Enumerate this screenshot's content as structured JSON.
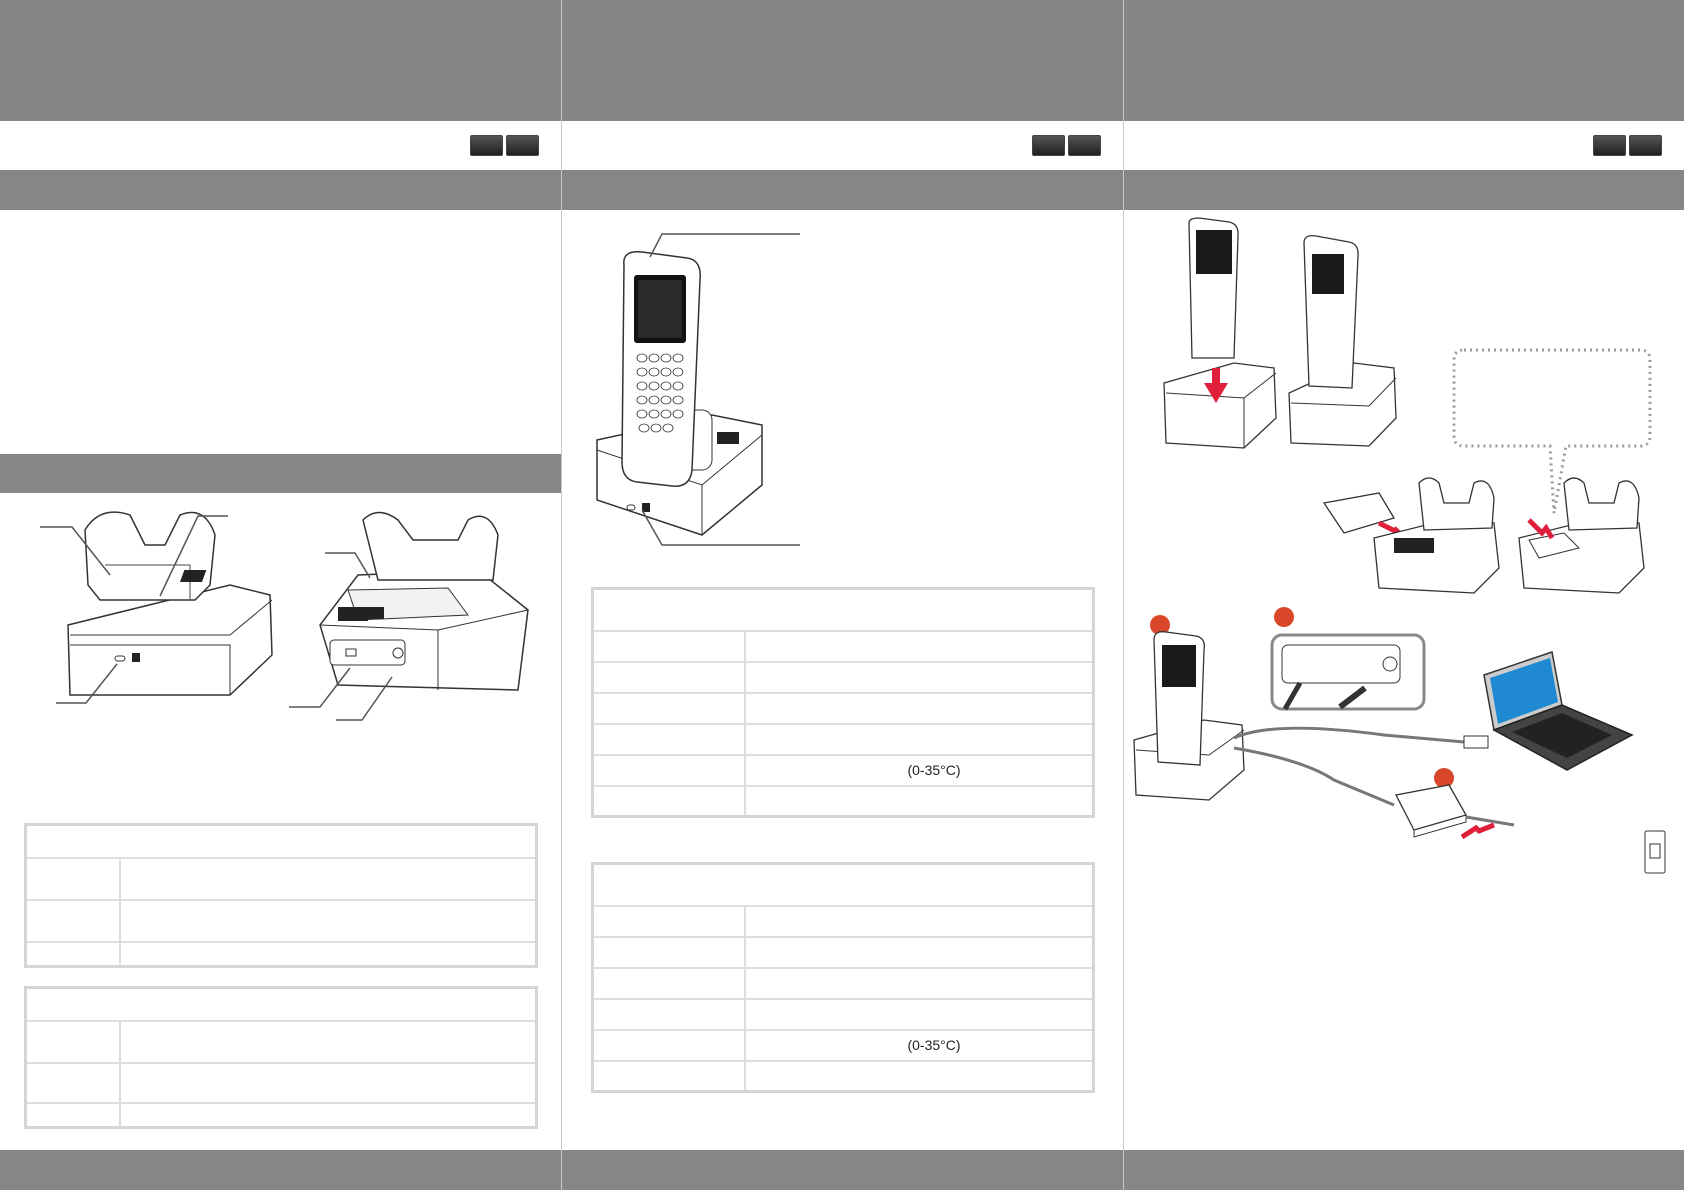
{
  "tables": {
    "cradle_spec_1": {
      "rows": [
        {
          "label": "",
          "value": ""
        },
        {
          "label": "",
          "value": ""
        },
        {
          "label": "",
          "value": ""
        },
        {
          "label": "",
          "value": ""
        },
        {
          "label": "",
          "value": "(0-35°C)"
        },
        {
          "label": "",
          "value": ""
        }
      ]
    },
    "cradle_spec_2": {
      "rows": [
        {
          "label": "",
          "value": ""
        },
        {
          "label": "",
          "value": ""
        },
        {
          "label": "",
          "value": ""
        },
        {
          "label": "",
          "value": ""
        },
        {
          "label": "",
          "value": "(0-35°C)"
        },
        {
          "label": "",
          "value": ""
        }
      ]
    }
  },
  "colors": {
    "band_gray": "#858687",
    "accent_red": "#d9472b",
    "arrow_red": "#e0203a",
    "laptop_screen": "#1f8ad1"
  },
  "icons": [
    "lang-tab-icon",
    "led-indicator-icon",
    "usb-icon",
    "power-jack-icon",
    "arrow-down-icon",
    "arrow-right-icon",
    "wall-outlet-icon"
  ]
}
